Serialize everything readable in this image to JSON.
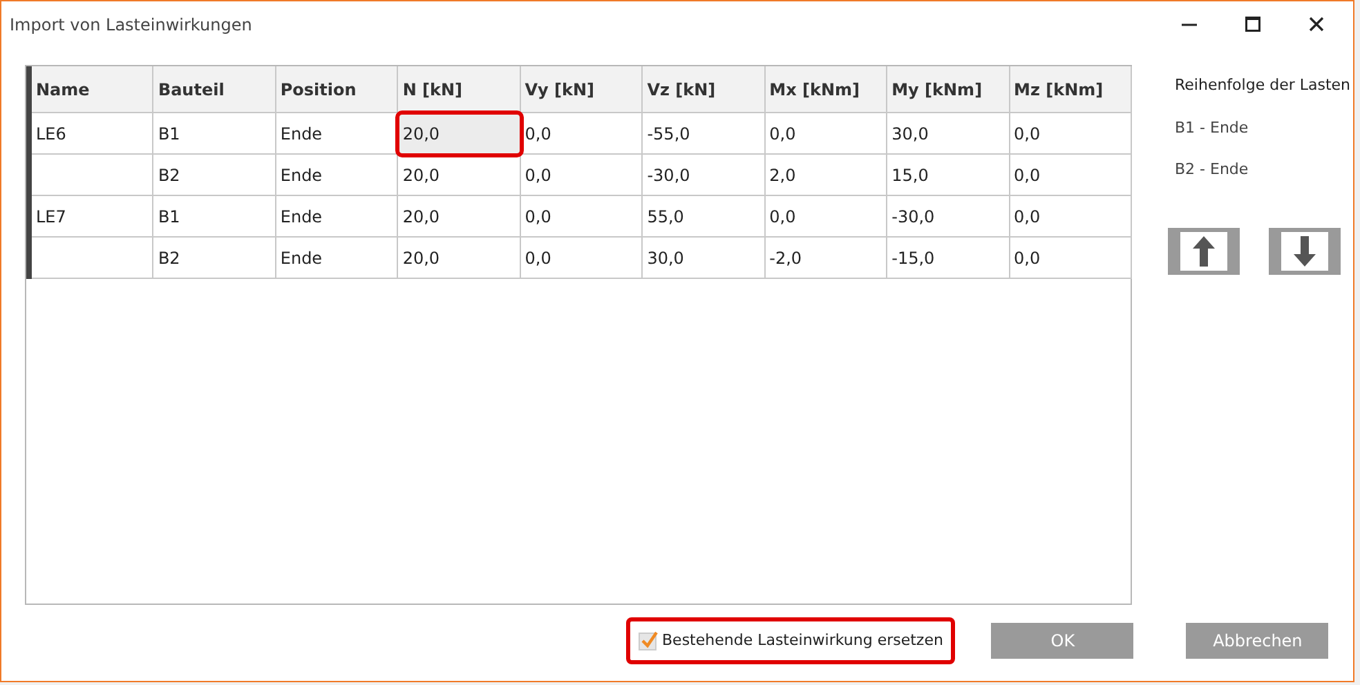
{
  "window": {
    "title": "Import von Lasteinwirkungen"
  },
  "table": {
    "columns": [
      "Name",
      "Bauteil",
      "Position",
      "N [kN]",
      "Vy [kN]",
      "Vz [kN]",
      "Mx [kNm]",
      "My [kNm]",
      "Mz [kNm]"
    ],
    "rows": [
      {
        "cells": [
          {
            "text": "LE6",
            "selected": false
          },
          {
            "text": "B1",
            "selected": false
          },
          {
            "text": "Ende",
            "selected": false
          },
          {
            "text": "20,0",
            "selected": true
          },
          {
            "text": "0,0",
            "selected": false
          },
          {
            "text": "-55,0",
            "selected": false
          },
          {
            "text": "0,0",
            "selected": false
          },
          {
            "text": "30,0",
            "selected": false
          },
          {
            "text": "0,0",
            "selected": false
          }
        ]
      },
      {
        "cells": [
          {
            "text": "",
            "selected": false
          },
          {
            "text": "B2",
            "selected": false
          },
          {
            "text": "Ende",
            "selected": false
          },
          {
            "text": "20,0",
            "selected": false
          },
          {
            "text": "0,0",
            "selected": false
          },
          {
            "text": "-30,0",
            "selected": false
          },
          {
            "text": "2,0",
            "selected": false
          },
          {
            "text": "15,0",
            "selected": false
          },
          {
            "text": "0,0",
            "selected": false
          }
        ]
      },
      {
        "cells": [
          {
            "text": "LE7",
            "selected": false
          },
          {
            "text": "B1",
            "selected": false
          },
          {
            "text": "Ende",
            "selected": false
          },
          {
            "text": "20,0",
            "selected": false
          },
          {
            "text": "0,0",
            "selected": false
          },
          {
            "text": "55,0",
            "selected": false
          },
          {
            "text": "0,0",
            "selected": false
          },
          {
            "text": "-30,0",
            "selected": false
          },
          {
            "text": "0,0",
            "selected": false
          }
        ]
      },
      {
        "cells": [
          {
            "text": "",
            "selected": false
          },
          {
            "text": "B2",
            "selected": false
          },
          {
            "text": "Ende",
            "selected": false
          },
          {
            "text": "20,0",
            "selected": false
          },
          {
            "text": "0,0",
            "selected": false
          },
          {
            "text": "30,0",
            "selected": false
          },
          {
            "text": "-2,0",
            "selected": false
          },
          {
            "text": "-15,0",
            "selected": false
          },
          {
            "text": "0,0",
            "selected": false
          }
        ]
      }
    ]
  },
  "order_panel": {
    "title": "Reihenfolge der Lasten",
    "items": [
      "B1 - Ende",
      "B2 - Ende"
    ]
  },
  "replace_checkbox": {
    "label": "Bestehende Lasteinwirkung ersetzen",
    "checked": true,
    "highlighted": true
  },
  "buttons": [
    "OK",
    "Abbrechen"
  ]
}
